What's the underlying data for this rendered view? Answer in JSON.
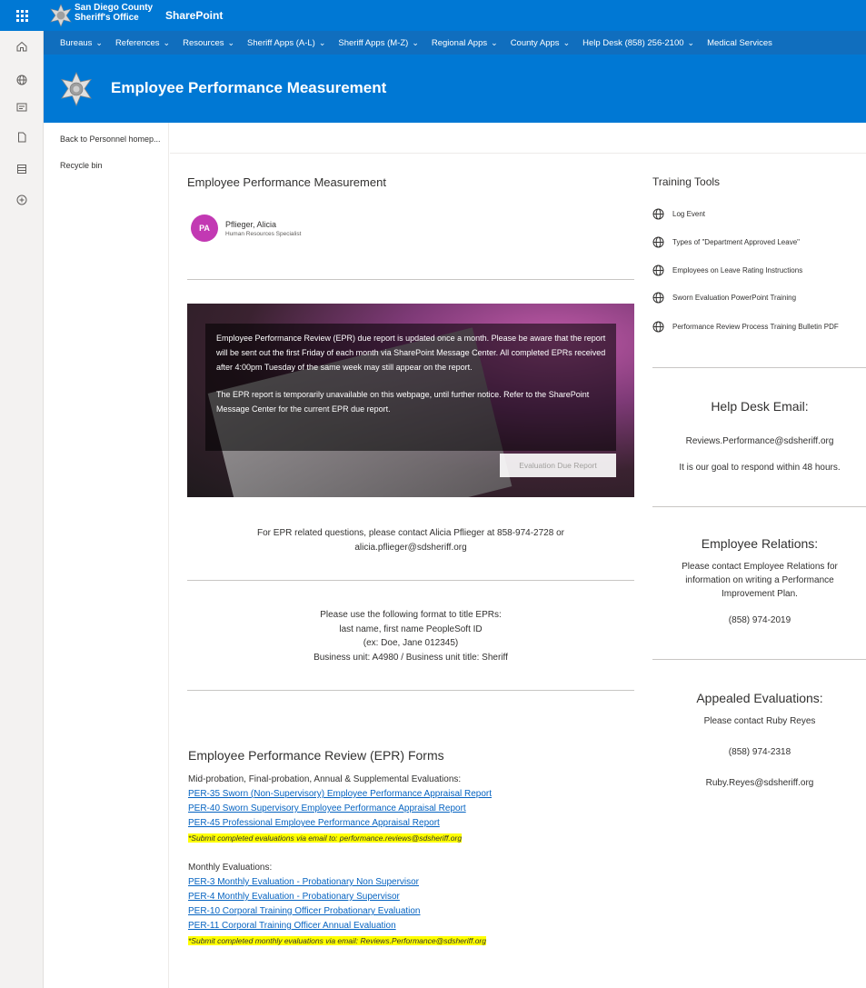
{
  "suite": {
    "org_line1": "San Diego County",
    "org_line2": "Sheriff's Office",
    "app_title": "SharePoint",
    "brand_color": "#0078d4"
  },
  "hubnav": [
    {
      "label": "Bureaus",
      "dropdown": true
    },
    {
      "label": "References",
      "dropdown": true
    },
    {
      "label": "Resources",
      "dropdown": true
    },
    {
      "label": "Sheriff Apps (A-L)",
      "dropdown": true
    },
    {
      "label": "Sheriff Apps (M-Z)",
      "dropdown": true
    },
    {
      "label": "Regional Apps",
      "dropdown": true
    },
    {
      "label": "County Apps",
      "dropdown": true
    },
    {
      "label": "Help Desk (858) 256-2100",
      "dropdown": true
    },
    {
      "label": "Medical Services",
      "dropdown": false
    }
  ],
  "site": {
    "title": "Employee Performance Measurement"
  },
  "quicklaunch": {
    "items": [
      "Back to Personnel homep...",
      "Recycle bin"
    ]
  },
  "rail_icons": [
    "home-icon",
    "globe-icon",
    "news-icon",
    "file-icon",
    "list-icon",
    "add-icon"
  ],
  "main": {
    "heading": "Employee Performance Measurement",
    "persona": {
      "initials": "PA",
      "name": "Pflieger, Alicia",
      "role": "Human Resources Specialist",
      "avatar_color": "#c239b3"
    },
    "hero": {
      "p1": "Employee Performance Review (EPR) due report is updated once a month. Please be aware that the report will be sent out the first Friday of each month via SharePoint Message Center. All completed EPRs received after 4:00pm Tuesday of the same week may still appear on the report.",
      "p2": "The EPR report is temporarily unavailable on this webpage, until further notice. Refer to the SharePoint Message Center for the current EPR due report.",
      "button": "Evaluation Due Report"
    },
    "contact": {
      "line1": "For EPR related questions, please contact Alicia Pflieger at 858-974-2728 or",
      "line2": "alicia.pflieger@sdsheriff.org"
    },
    "format": {
      "line1": "Please use the following format to title EPRs:",
      "line2": "last name, first name PeopleSoft ID",
      "line3": "(ex: Doe, Jane 012345)",
      "line4": "Business unit: A4980 / Business unit title: Sheriff"
    },
    "forms": {
      "title": "Employee Performance Review (EPR) Forms",
      "intro": "Mid-probation, Final-probation, Annual & Supplemental Evaluations:",
      "links1": [
        "PER-35 Sworn (Non-Supervisory) Employee Performance Appraisal Report",
        "PER-40 Sworn Supervisory Employee Performance Appraisal Report",
        "PER-45 Professional Employee Performance Appraisal Report"
      ],
      "note1": "*Submit completed evaluations via email to: performance.reviews@sdsheriff.org",
      "monthly_intro": "Monthly Evaluations:",
      "links2": [
        "PER-3 Monthly Evaluation - Probationary Non Supervisor",
        "PER-4 Monthly Evaluation - Probationary Supervisor",
        "PER-10 Corporal Training Officer Probationary Evaluation",
        "PER-11 Corporal Training Officer Annual Evaluation"
      ],
      "note2": "*Submit completed monthly evaluations via email: Reviews.Performance@sdsheriff.org"
    }
  },
  "right": {
    "tools_heading": "Training Tools",
    "tools": [
      "Log Event",
      "Types of \"Department Approved Leave\"",
      "Employees on Leave Rating Instructions",
      "Sworn Evaluation PowerPoint Training",
      "Performance Review Process Training Bulletin PDF"
    ],
    "helpdesk": {
      "heading": "Help Desk Email:",
      "email": "Reviews.Performance@sdsheriff.org",
      "note": "It is our goal to respond within 48 hours."
    },
    "relations": {
      "heading": "Employee Relations:",
      "text": "Please contact Employee Relations for information on writing a Performance Improvement Plan.",
      "phone": "(858) 974-2019"
    },
    "appealed": {
      "heading": "Appealed Evaluations:",
      "contact": "Please contact Ruby Reyes",
      "phone": "(858) 974-2318",
      "email": "Ruby.Reyes@sdsheriff.org"
    }
  }
}
